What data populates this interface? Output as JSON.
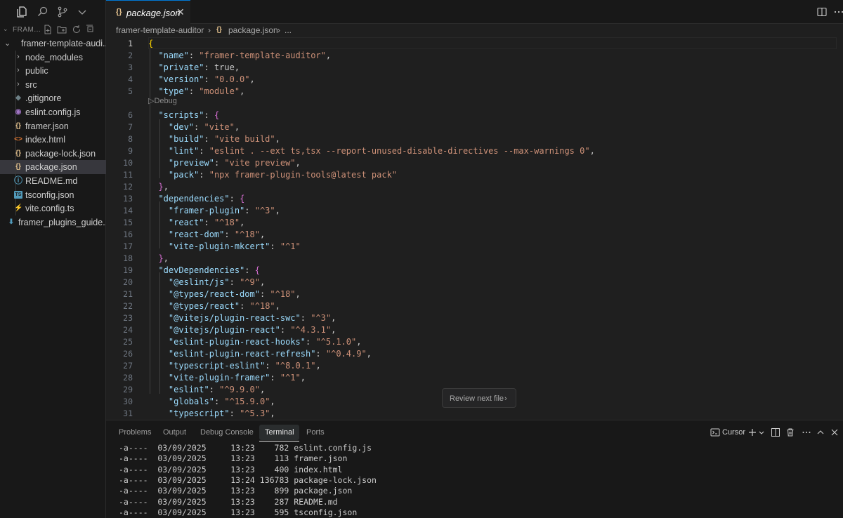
{
  "activity": {
    "icons": [
      "files-icon",
      "search-icon",
      "source-control-icon",
      "chevron-down-icon"
    ]
  },
  "explorer": {
    "header": "FRAM...",
    "root": "framer-template-audi...",
    "items": [
      {
        "label": "node_modules",
        "type": "folder",
        "icon": ""
      },
      {
        "label": "public",
        "type": "folder",
        "icon": ""
      },
      {
        "label": "src",
        "type": "folder",
        "icon": ""
      },
      {
        "label": ".gitignore",
        "type": "file",
        "icon": "git-icon",
        "color": "#6d8086"
      },
      {
        "label": "eslint.config.js",
        "type": "file",
        "icon": "eslint-icon",
        "color": "#a074c4"
      },
      {
        "label": "framer.json",
        "type": "file",
        "icon": "json-icon",
        "color": "#e2c08d"
      },
      {
        "label": "index.html",
        "type": "file",
        "icon": "html-icon",
        "color": "#e37933"
      },
      {
        "label": "package-lock.json",
        "type": "file",
        "icon": "json-icon",
        "color": "#e2c08d"
      },
      {
        "label": "package.json",
        "type": "file",
        "icon": "json-icon",
        "color": "#e2c08d",
        "selected": true
      },
      {
        "label": "README.md",
        "type": "file",
        "icon": "info-icon",
        "color": "#519aba"
      },
      {
        "label": "tsconfig.json",
        "type": "file",
        "icon": "ts-icon",
        "color": "#519aba"
      },
      {
        "label": "vite.config.ts",
        "type": "file",
        "icon": "vite-icon",
        "color": "#ffd62e"
      },
      {
        "label": "framer_plugins_guide....",
        "type": "file",
        "icon": "download-icon",
        "color": "#519aba",
        "outside": true
      }
    ]
  },
  "tab": {
    "icon": "{}",
    "label": "package.json",
    "close": "✕"
  },
  "breadcrumb": {
    "folder": "framer-template-auditor",
    "sep1": "›",
    "file_icon": "{}",
    "file": "package.json",
    "sep2": "›",
    "tail": "..."
  },
  "editor": {
    "current_line": 1,
    "codelens": "Debug",
    "lines": [
      {
        "n": 1,
        "tokens": [
          [
            "b1",
            "{"
          ]
        ]
      },
      {
        "n": 2,
        "tokens": [
          [
            "p",
            "  "
          ],
          [
            "k",
            "\"name\""
          ],
          [
            "p",
            ": "
          ],
          [
            "s",
            "\"framer-template-auditor\""
          ],
          [
            "p",
            ","
          ]
        ]
      },
      {
        "n": 3,
        "tokens": [
          [
            "p",
            "  "
          ],
          [
            "k",
            "\"private\""
          ],
          [
            "p",
            ": "
          ],
          [
            "p",
            "true"
          ],
          [
            "p",
            ","
          ]
        ]
      },
      {
        "n": 4,
        "tokens": [
          [
            "p",
            "  "
          ],
          [
            "k",
            "\"version\""
          ],
          [
            "p",
            ": "
          ],
          [
            "s",
            "\"0.0.0\""
          ],
          [
            "p",
            ","
          ]
        ]
      },
      {
        "n": 5,
        "tokens": [
          [
            "p",
            "  "
          ],
          [
            "k",
            "\"type\""
          ],
          [
            "p",
            ": "
          ],
          [
            "s",
            "\"module\""
          ],
          [
            "p",
            ","
          ]
        ]
      },
      {
        "n": 6,
        "tokens": [
          [
            "p",
            "  "
          ],
          [
            "k",
            "\"scripts\""
          ],
          [
            "p",
            ": "
          ],
          [
            "b2",
            "{"
          ]
        ]
      },
      {
        "n": 7,
        "tokens": [
          [
            "p",
            "    "
          ],
          [
            "k",
            "\"dev\""
          ],
          [
            "p",
            ": "
          ],
          [
            "s",
            "\"vite\""
          ],
          [
            "p",
            ","
          ]
        ]
      },
      {
        "n": 8,
        "tokens": [
          [
            "p",
            "    "
          ],
          [
            "k",
            "\"build\""
          ],
          [
            "p",
            ": "
          ],
          [
            "s",
            "\"vite build\""
          ],
          [
            "p",
            ","
          ]
        ]
      },
      {
        "n": 9,
        "tokens": [
          [
            "p",
            "    "
          ],
          [
            "k",
            "\"lint\""
          ],
          [
            "p",
            ": "
          ],
          [
            "s",
            "\"eslint . --ext ts,tsx --report-unused-disable-directives --max-warnings 0\""
          ],
          [
            "p",
            ","
          ]
        ]
      },
      {
        "n": 10,
        "tokens": [
          [
            "p",
            "    "
          ],
          [
            "k",
            "\"preview\""
          ],
          [
            "p",
            ": "
          ],
          [
            "s",
            "\"vite preview\""
          ],
          [
            "p",
            ","
          ]
        ]
      },
      {
        "n": 11,
        "tokens": [
          [
            "p",
            "    "
          ],
          [
            "k",
            "\"pack\""
          ],
          [
            "p",
            ": "
          ],
          [
            "s",
            "\"npx framer-plugin-tools@latest pack\""
          ]
        ]
      },
      {
        "n": 12,
        "tokens": [
          [
            "p",
            "  "
          ],
          [
            "b2",
            "}"
          ],
          [
            "p",
            ","
          ]
        ]
      },
      {
        "n": 13,
        "tokens": [
          [
            "p",
            "  "
          ],
          [
            "k",
            "\"dependencies\""
          ],
          [
            "p",
            ": "
          ],
          [
            "b2",
            "{"
          ]
        ]
      },
      {
        "n": 14,
        "tokens": [
          [
            "p",
            "    "
          ],
          [
            "k",
            "\"framer-plugin\""
          ],
          [
            "p",
            ": "
          ],
          [
            "s",
            "\"^3\""
          ],
          [
            "p",
            ","
          ]
        ]
      },
      {
        "n": 15,
        "tokens": [
          [
            "p",
            "    "
          ],
          [
            "k",
            "\"react\""
          ],
          [
            "p",
            ": "
          ],
          [
            "s",
            "\"^18\""
          ],
          [
            "p",
            ","
          ]
        ]
      },
      {
        "n": 16,
        "tokens": [
          [
            "p",
            "    "
          ],
          [
            "k",
            "\"react-dom\""
          ],
          [
            "p",
            ": "
          ],
          [
            "s",
            "\"^18\""
          ],
          [
            "p",
            ","
          ]
        ]
      },
      {
        "n": 17,
        "tokens": [
          [
            "p",
            "    "
          ],
          [
            "k",
            "\"vite-plugin-mkcert\""
          ],
          [
            "p",
            ": "
          ],
          [
            "s",
            "\"^1\""
          ]
        ]
      },
      {
        "n": 18,
        "tokens": [
          [
            "p",
            "  "
          ],
          [
            "b2",
            "}"
          ],
          [
            "p",
            ","
          ]
        ]
      },
      {
        "n": 19,
        "tokens": [
          [
            "p",
            "  "
          ],
          [
            "k",
            "\"devDependencies\""
          ],
          [
            "p",
            ": "
          ],
          [
            "b2",
            "{"
          ]
        ]
      },
      {
        "n": 20,
        "tokens": [
          [
            "p",
            "    "
          ],
          [
            "k",
            "\"@eslint/js\""
          ],
          [
            "p",
            ": "
          ],
          [
            "s",
            "\"^9\""
          ],
          [
            "p",
            ","
          ]
        ]
      },
      {
        "n": 21,
        "tokens": [
          [
            "p",
            "    "
          ],
          [
            "k",
            "\"@types/react-dom\""
          ],
          [
            "p",
            ": "
          ],
          [
            "s",
            "\"^18\""
          ],
          [
            "p",
            ","
          ]
        ]
      },
      {
        "n": 22,
        "tokens": [
          [
            "p",
            "    "
          ],
          [
            "k",
            "\"@types/react\""
          ],
          [
            "p",
            ": "
          ],
          [
            "s",
            "\"^18\""
          ],
          [
            "p",
            ","
          ]
        ]
      },
      {
        "n": 23,
        "tokens": [
          [
            "p",
            "    "
          ],
          [
            "k",
            "\"@vitejs/plugin-react-swc\""
          ],
          [
            "p",
            ": "
          ],
          [
            "s",
            "\"^3\""
          ],
          [
            "p",
            ","
          ]
        ]
      },
      {
        "n": 24,
        "tokens": [
          [
            "p",
            "    "
          ],
          [
            "k",
            "\"@vitejs/plugin-react\""
          ],
          [
            "p",
            ": "
          ],
          [
            "s",
            "\"^4.3.1\""
          ],
          [
            "p",
            ","
          ]
        ]
      },
      {
        "n": 25,
        "tokens": [
          [
            "p",
            "    "
          ],
          [
            "k",
            "\"eslint-plugin-react-hooks\""
          ],
          [
            "p",
            ": "
          ],
          [
            "s",
            "\"^5.1.0\""
          ],
          [
            "p",
            ","
          ]
        ]
      },
      {
        "n": 26,
        "tokens": [
          [
            "p",
            "    "
          ],
          [
            "k",
            "\"eslint-plugin-react-refresh\""
          ],
          [
            "p",
            ": "
          ],
          [
            "s",
            "\"^0.4.9\""
          ],
          [
            "p",
            ","
          ]
        ]
      },
      {
        "n": 27,
        "tokens": [
          [
            "p",
            "    "
          ],
          [
            "k",
            "\"typescript-eslint\""
          ],
          [
            "p",
            ": "
          ],
          [
            "s",
            "\"^8.0.1\""
          ],
          [
            "p",
            ","
          ]
        ]
      },
      {
        "n": 28,
        "tokens": [
          [
            "p",
            "    "
          ],
          [
            "k",
            "\"vite-plugin-framer\""
          ],
          [
            "p",
            ": "
          ],
          [
            "s",
            "\"^1\""
          ],
          [
            "p",
            ","
          ]
        ]
      },
      {
        "n": 29,
        "tokens": [
          [
            "p",
            "    "
          ],
          [
            "k",
            "\"eslint\""
          ],
          [
            "p",
            ": "
          ],
          [
            "s",
            "\"^9.9.0\""
          ],
          [
            "p",
            ","
          ]
        ]
      },
      {
        "n": 30,
        "tokens": [
          [
            "p",
            "    "
          ],
          [
            "k",
            "\"globals\""
          ],
          [
            "p",
            ": "
          ],
          [
            "s",
            "\"^15.9.0\""
          ],
          [
            "p",
            ","
          ]
        ]
      },
      {
        "n": 31,
        "tokens": [
          [
            "p",
            "    "
          ],
          [
            "k",
            "\"typescript\""
          ],
          [
            "p",
            ": "
          ],
          [
            "s",
            "\"^5.3\""
          ],
          [
            "p",
            ","
          ]
        ]
      }
    ]
  },
  "review": {
    "label": "Review next file",
    "chevron": "›"
  },
  "panel": {
    "tabs": [
      "Problems",
      "Output",
      "Debug Console",
      "Terminal",
      "Ports"
    ],
    "active_tab": "Terminal",
    "terminal_name": "Cursor",
    "terminal_lines": [
      "-a----  03/09/2025     13:23    782 eslint.config.js",
      "-a----  03/09/2025     13:23    113 framer.json",
      "-a----  03/09/2025     13:23    400 index.html",
      "-a----  03/09/2025     13:24 136783 package-lock.json",
      "-a----  03/09/2025     13:23    899 package.json",
      "-a----  03/09/2025     13:23    287 README.md",
      "-a----  03/09/2025     13:23    595 tsconfig.json"
    ]
  },
  "colors": {
    "accent": "#0078d4",
    "key": "#9cdcfe",
    "string": "#ce9178",
    "bracket1": "#ffd700",
    "bracket2": "#da70d6"
  }
}
